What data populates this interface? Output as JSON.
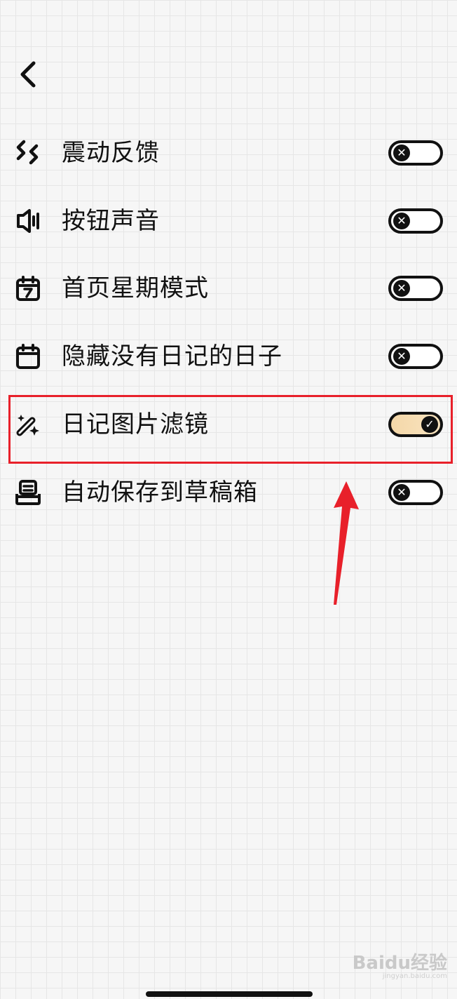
{
  "back_icon": "chevron-left-icon",
  "settings": [
    {
      "label": "震动反馈",
      "icon": "vibration-icon",
      "enabled": false
    },
    {
      "label": "按钮声音",
      "icon": "speaker-icon",
      "enabled": false
    },
    {
      "label": "首页星期模式",
      "icon": "calendar-week-icon",
      "enabled": false
    },
    {
      "label": "隐藏没有日记的日子",
      "icon": "calendar-icon",
      "enabled": false
    },
    {
      "label": "日记图片滤镜",
      "icon": "magic-wand-icon",
      "enabled": true
    },
    {
      "label": "自动保存到草稿箱",
      "icon": "drafts-tray-icon",
      "enabled": false
    }
  ],
  "colors": {
    "highlight": "#e8202a",
    "toggle_on": "#f4d7a8",
    "text": "#111111",
    "background": "#f6f6f6"
  },
  "watermark": {
    "text": "Baidu经验",
    "sub": "jingyan.baidu.com"
  }
}
